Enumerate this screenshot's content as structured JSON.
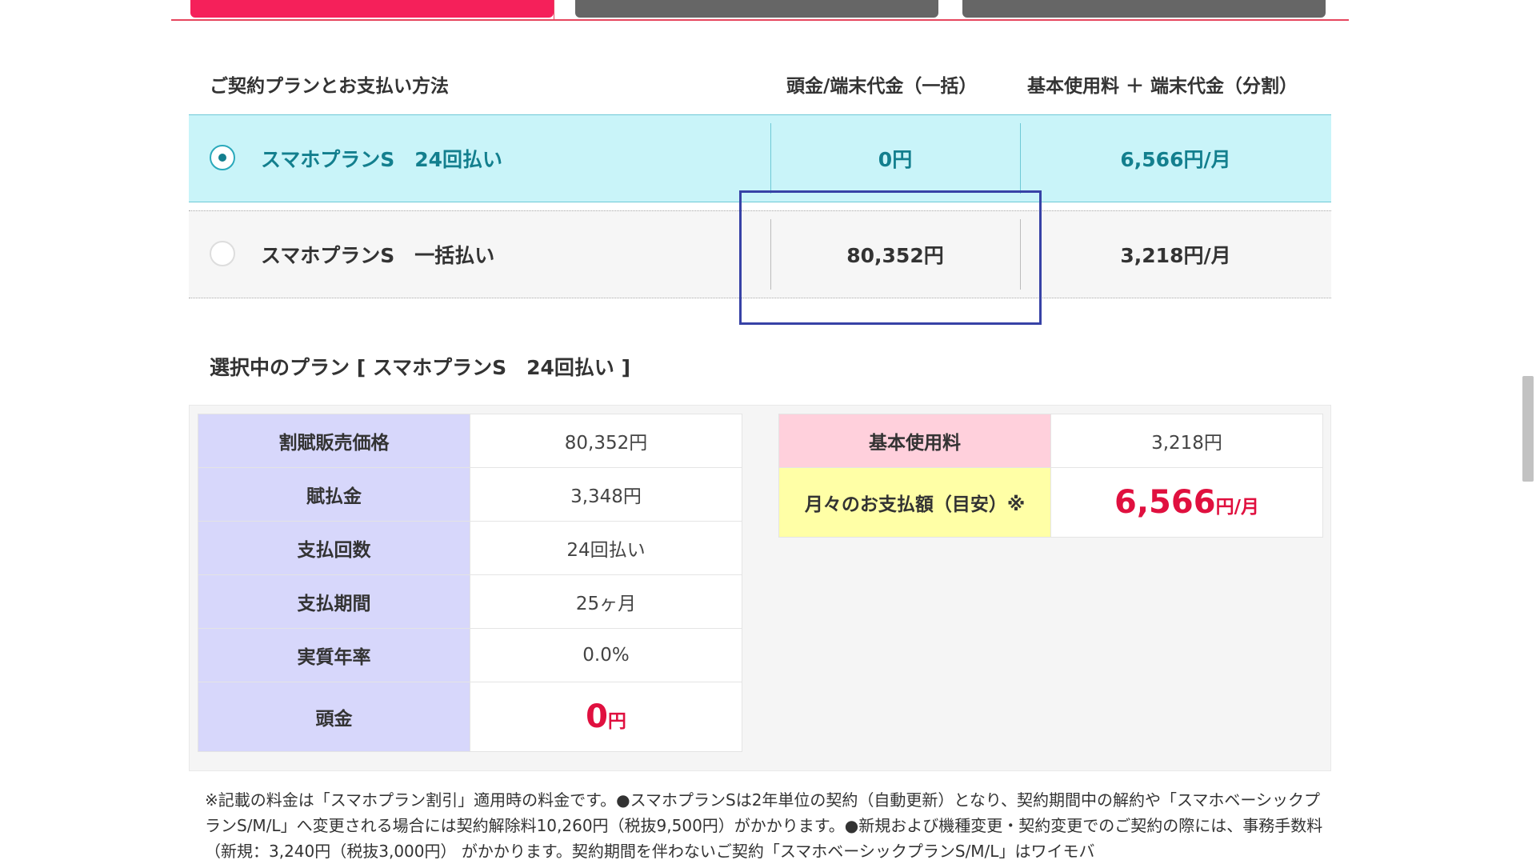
{
  "plan_section": {
    "heading": "ご契約プランとお支払い方法",
    "col_down_payment": "頭金/端末代金（一括）",
    "col_monthly": "基本使用料 ＋ 端末代金（分割）",
    "plans": [
      {
        "name": "スマホプランS　24回払い",
        "down_payment": "0円",
        "monthly": "6,566円/月",
        "selected": true
      },
      {
        "name": "スマホプランS　一括払い",
        "down_payment": "80,352円",
        "monthly": "3,218円/月",
        "selected": false
      }
    ]
  },
  "selected_plan": {
    "title": "選択中のプラン [ スマホプランS　24回払い ]",
    "left_rows": [
      {
        "label": "割賦販売価格",
        "value": "80,352円"
      },
      {
        "label": "賦払金",
        "value": "3,348円"
      },
      {
        "label": "支払回数",
        "value": "24回払い"
      },
      {
        "label": "支払期間",
        "value": "25ヶ月"
      },
      {
        "label": "実質年率",
        "value": "0.0%"
      }
    ],
    "down_payment_label": "頭金",
    "down_payment_number": "0",
    "down_payment_unit": "円",
    "base_fee_label": "基本使用料",
    "base_fee_value": "3,218円",
    "monthly_label": "月々のお支払額（目安）※",
    "monthly_number": "6,566",
    "monthly_unit": "円/月"
  },
  "note": {
    "text": "※記載の料金は「スマホプラン割引」適用時の料金です。●スマホプランSは2年単位の契約（自動更新）となり、契約期間中の解約や「スマホベーシックプランS/M/L」へ変更される場合には契約解除料10,260円（税抜9,500円）がかかります。●新規および機種変更・契約変更でのご契約の際には、事務手数料（新規：3,240円（税抜3,000円） がかかります。契約期間を伴わないご契約「スマホベーシックプランS/M/L」はワイモバ"
  },
  "colors": {
    "accent_pink": "#f5205a",
    "selected_row_bg": "#c9f4f9",
    "selected_row_text": "#137f8e",
    "price_red": "#e0103f",
    "label_lavender": "#d7d7fb",
    "label_pink": "#ffd0dc",
    "label_yellow": "#ffffa6",
    "highlight_box": "#3742a6"
  }
}
